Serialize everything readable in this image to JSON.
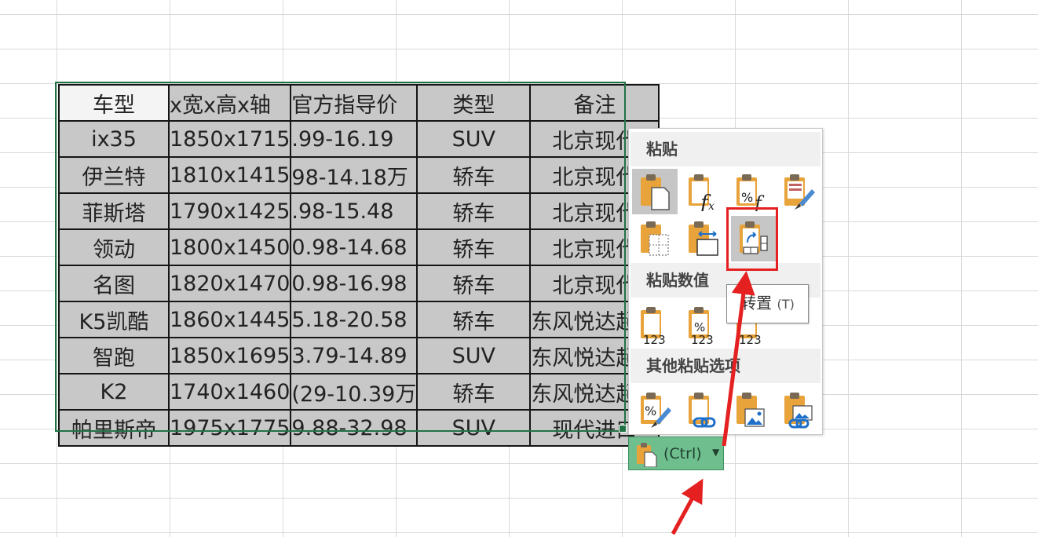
{
  "table": {
    "headers": [
      "车型",
      "x宽x高x轴",
      "官方指导价",
      "类型",
      "备注"
    ],
    "rows": [
      [
        "ix35",
        "1850x1715",
        ".99-16.19",
        "SUV",
        "北京现代"
      ],
      [
        "伊兰特",
        "1810x1415",
        "98-14.18万",
        "轿车",
        "北京现代"
      ],
      [
        "菲斯塔",
        "1790x1425",
        ".98-15.48",
        "轿车",
        "北京现代"
      ],
      [
        "领动",
        "1800x1450",
        "0.98-14.68",
        "轿车",
        "北京现代"
      ],
      [
        "名图",
        "1820x1470",
        "0.98-16.98",
        "轿车",
        "北京现代"
      ],
      [
        "K5凯酷",
        "1860x1445",
        "5.18-20.58",
        "轿车",
        "东风悦达起亚"
      ],
      [
        "智跑",
        "1850x1695",
        "3.79-14.89",
        "SUV",
        "东风悦达起亚"
      ],
      [
        "K2",
        "1740x1460",
        "(29-10.39万",
        "轿车",
        "东风悦达起亚"
      ],
      [
        "帕里斯帝",
        "1975x1775",
        "9.88-32.98",
        "SUV",
        "现代进口"
      ]
    ]
  },
  "paste_menu": {
    "section_paste": "粘贴",
    "section_values": "粘贴数值",
    "section_other": "其他粘贴选项",
    "icon_digits": "123",
    "icon_percent": "%"
  },
  "tooltip": {
    "label": "转置",
    "shortcut": "(T)"
  },
  "ctrl_button": {
    "label": "(Ctrl)"
  },
  "colors": {
    "selection": "#217346",
    "highlight": "#e52020",
    "clipboard": "#e8a33a",
    "link": "#1e6fc8"
  }
}
